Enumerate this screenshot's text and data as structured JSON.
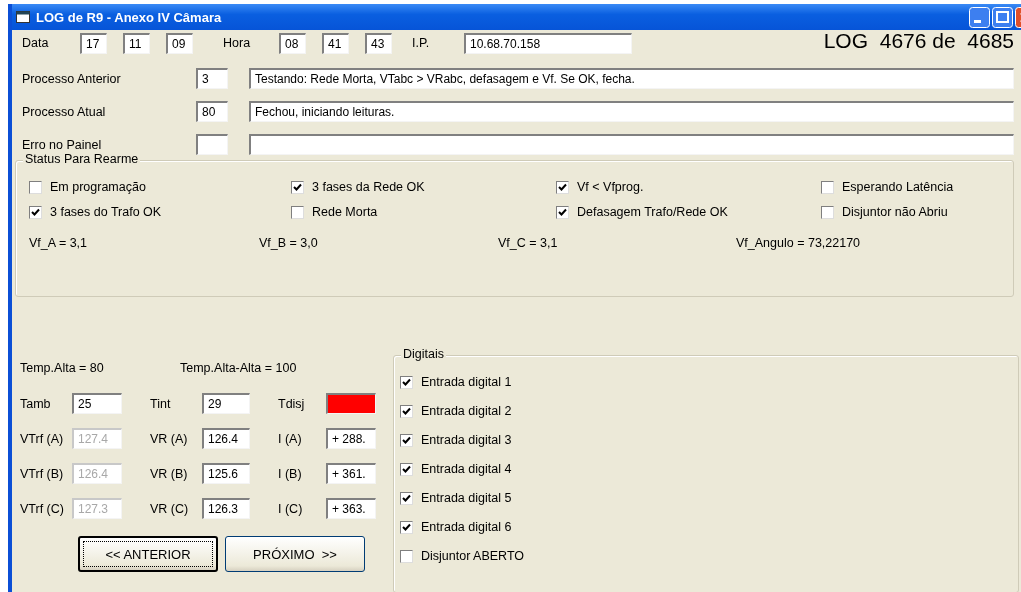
{
  "window": {
    "title": "LOG de R9 - Anexo IV Câmara"
  },
  "header": {
    "data_label": "Data",
    "date": [
      "17",
      "11",
      "09"
    ],
    "hora_label": "Hora",
    "time": [
      "08",
      "41",
      "43"
    ],
    "ip_label": "I.P.",
    "ip": "10.68.70.158",
    "log_counter": "LOG  4676 de  4685"
  },
  "process_rows": [
    {
      "label": "Processo Anterior",
      "code": "3",
      "description": "Testando: Rede Morta, VTabc > VRabc, defasagem e Vf. Se OK, fecha."
    },
    {
      "label": "Processo Atual",
      "code": "80",
      "description": "Fechou, iniciando leituras."
    },
    {
      "label": "Erro no Painel"
    }
  ],
  "status": {
    "title": "Status Para Rearme",
    "checkboxes": [
      {
        "label": "Em programação",
        "checked": false
      },
      {
        "label": "3 fases da Rede OK",
        "checked": true
      },
      {
        "label": "Vf < Vfprog.",
        "checked": true
      },
      {
        "label": "Esperando Latência",
        "checked": false
      },
      {
        "label": "3 fases do Trafo OK",
        "checked": true
      },
      {
        "label": "Rede Morta",
        "checked": false
      },
      {
        "label": "Defasagem Trafo/Rede OK",
        "checked": true
      },
      {
        "label": "Disjuntor não Abriu",
        "checked": false
      }
    ],
    "readings": [
      "Vf_A = 3,1",
      "Vf_B = 3,0",
      "Vf_C = 3,1",
      "Vf_Angulo = 73,22170"
    ]
  },
  "temperatures": [
    "Temp.Alta = 80",
    "Temp.Alta-Alta = 100"
  ],
  "measurements": [
    [
      {
        "label": "Tamb",
        "value": "25",
        "disabled": false
      },
      {
        "label": "Tint",
        "value": "29",
        "disabled": false
      },
      {
        "label": "Tdisj",
        "disabled": false,
        "color": "#ff0000"
      }
    ],
    [
      {
        "label": "VTrf (A)",
        "value": "127.4",
        "disabled": true
      },
      {
        "label": "VR (A)",
        "value": "126.4",
        "disabled": false
      },
      {
        "label": "I (A)",
        "value": "+ 288.",
        "disabled": false
      }
    ],
    [
      {
        "label": "VTrf (B)",
        "value": "126.4",
        "disabled": true
      },
      {
        "label": "VR (B)",
        "value": "125.6",
        "disabled": false
      },
      {
        "label": "I (B)",
        "value": "+ 361.",
        "disabled": false
      }
    ],
    [
      {
        "label": "VTrf (C)",
        "value": "127.3",
        "disabled": true
      },
      {
        "label": "VR (C)",
        "value": "126.3",
        "disabled": false
      },
      {
        "label": "I (C)",
        "value": "+ 363.",
        "disabled": false
      }
    ]
  ],
  "buttons": [
    {
      "label": "<< ANTERIOR",
      "focused": true
    },
    {
      "label": "PRÓXIMO  >>",
      "focused": false
    }
  ],
  "digitais": {
    "title": "Digitais",
    "checkboxes": [
      {
        "label": "Entrada digital 1",
        "checked": true
      },
      {
        "label": "Entrada digital 2",
        "checked": true
      },
      {
        "label": "Entrada digital 3",
        "checked": true
      },
      {
        "label": "Entrada digital 4",
        "checked": true
      },
      {
        "label": "Entrada digital 5",
        "checked": true
      },
      {
        "label": "Entrada digital 6",
        "checked": true
      },
      {
        "label": "Disjuntor ABERTO",
        "checked": false
      }
    ]
  }
}
